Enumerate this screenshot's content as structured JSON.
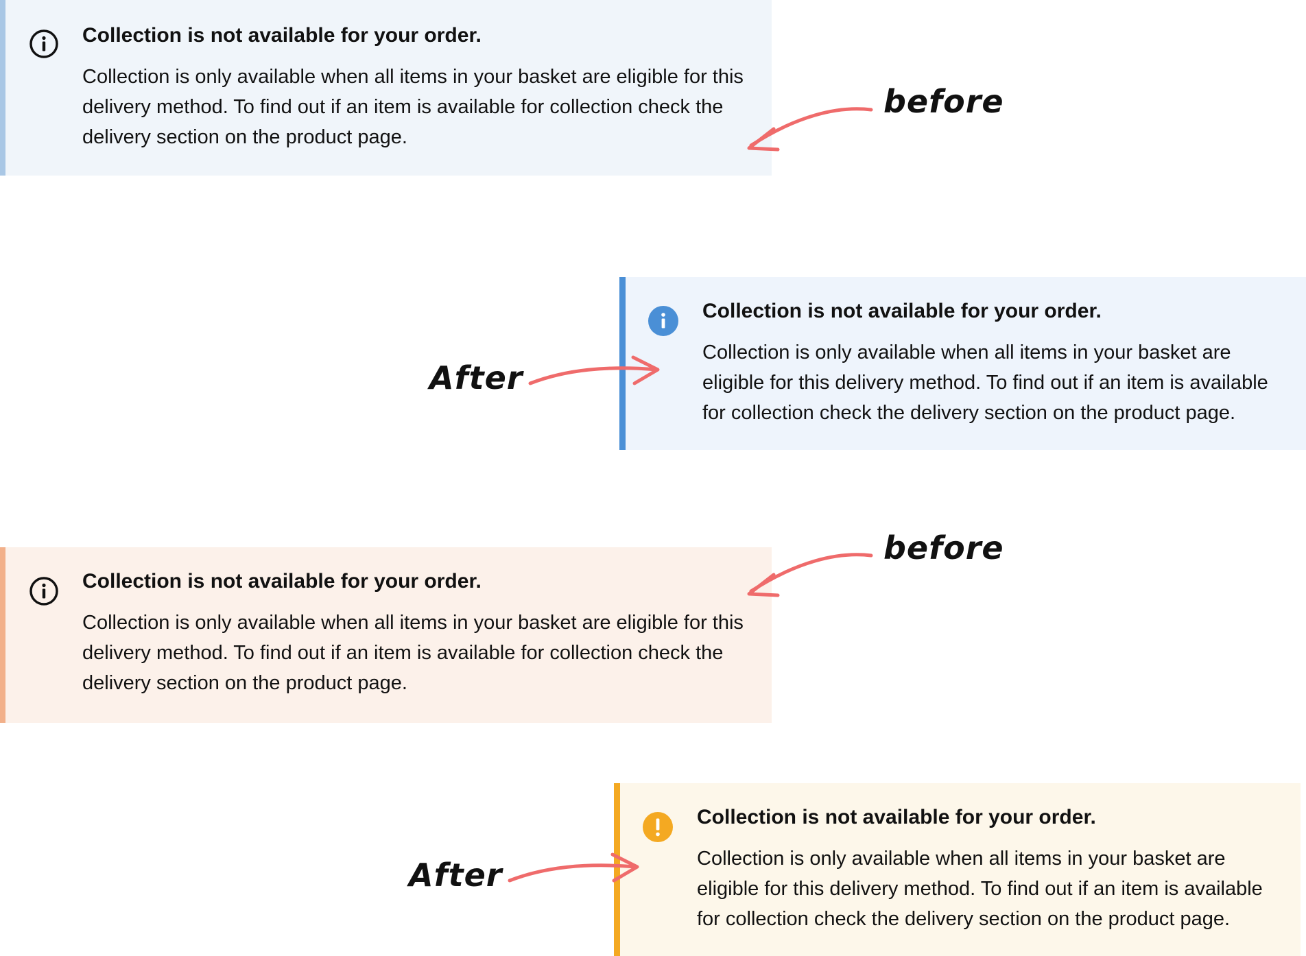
{
  "alerts": [
    {
      "variant": "info-before",
      "title": "Collection is not available for your order.",
      "body": "Collection is only available when all items in your basket are eligible for this delivery method. To find out if an item is available for collection check the delivery section on the product page.",
      "icon": "info-outline-icon",
      "colors": {
        "background": "#f0f5fa",
        "stripe": "#a9c7e5",
        "icon": "#111111"
      }
    },
    {
      "variant": "info-after",
      "title": "Collection is not available for your order.",
      "body": "Collection is only available when all items in your basket are eligible for this delivery method. To find out if an item is available for collection check the delivery section on the product page.",
      "icon": "info-filled-icon",
      "colors": {
        "background": "#eef4fc",
        "stripe": "#4a8fd6",
        "icon": "#4a8fd6"
      }
    },
    {
      "variant": "warning-before",
      "title": "Collection is not available for your order.",
      "body": "Collection is only available when all items in your basket are eligible for this delivery method. To find out if an item is available for collection check the delivery section on the product page.",
      "icon": "info-outline-icon",
      "colors": {
        "background": "#fcf1ea",
        "stripe": "#f2b08a",
        "icon": "#111111"
      }
    },
    {
      "variant": "warning-after",
      "title": "Collection is not available for your order.",
      "body": "Collection is only available when all items in your basket are eligible for this delivery method. To find out if an item is available for collection check the delivery section on the product page.",
      "icon": "exclamation-filled-icon",
      "colors": {
        "background": "#fdf7ea",
        "stripe": "#f4a922",
        "icon": "#f4a922"
      }
    }
  ],
  "annotations": {
    "before_1": "before",
    "after_1": "After",
    "before_2": "before",
    "after_2": "After",
    "arrow_color": "#ef6b6b"
  }
}
